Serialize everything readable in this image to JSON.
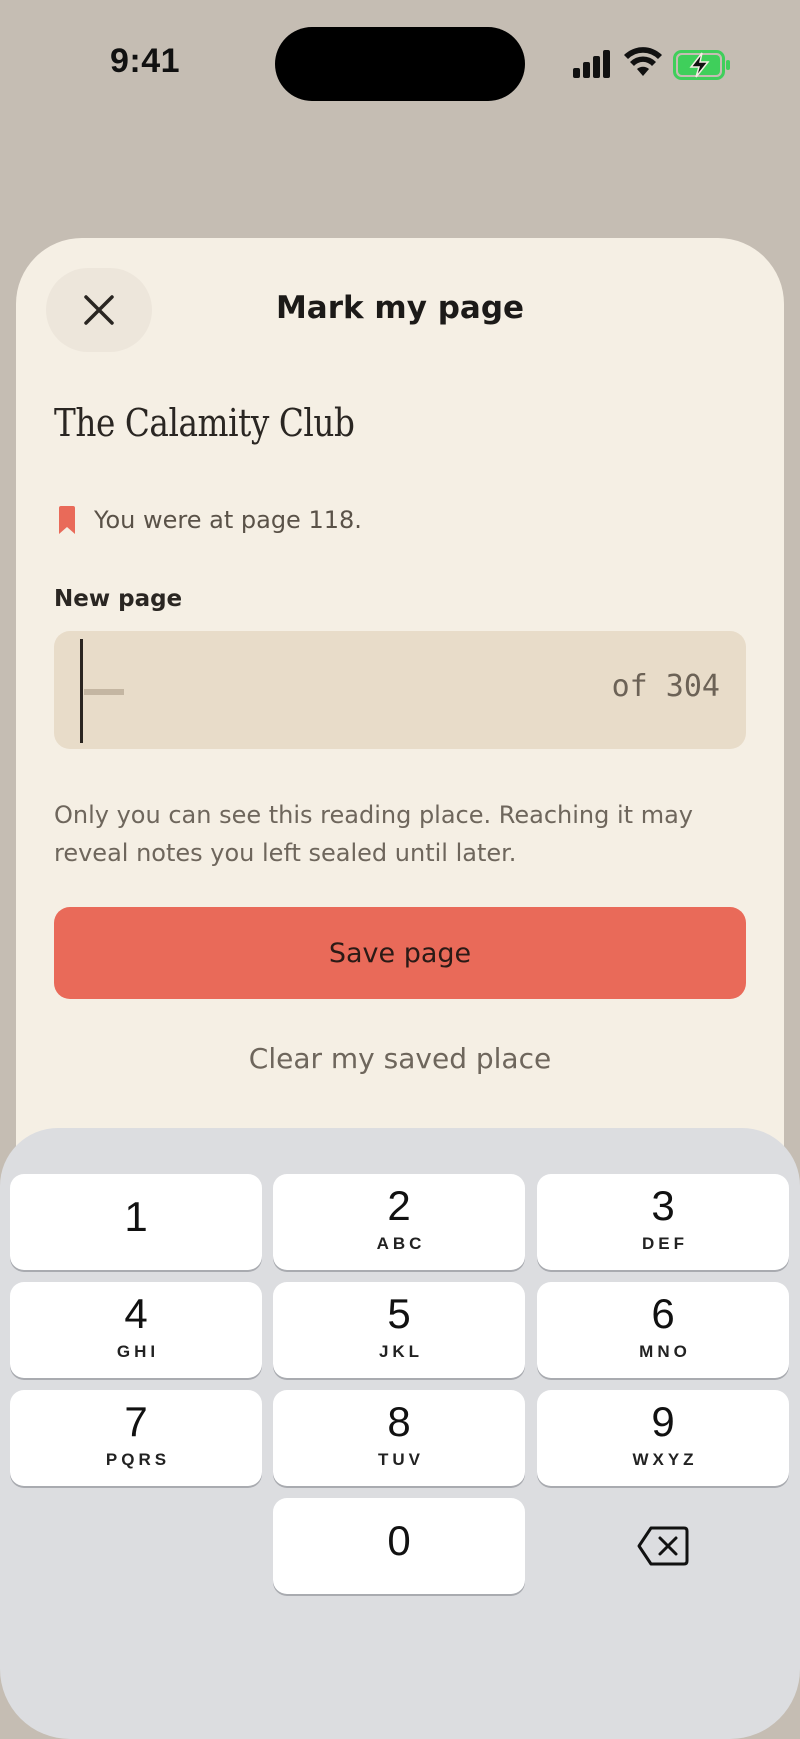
{
  "status_bar": {
    "time": "9:41",
    "icons": [
      "cellular-signal-icon",
      "wifi-icon",
      "battery-charging-icon"
    ],
    "battery_color": "#3fcf5b"
  },
  "sheet": {
    "title": "Mark my page",
    "close_icon": "close-icon",
    "book_title": "The Calamity Club",
    "previous_page_text": "You were at page 118.",
    "bookmark_color": "#e96a59",
    "new_page_label": "New page",
    "page_input": {
      "value": "",
      "total_text": "of 304"
    },
    "hint_text": "Only you can see this reading place. Reaching it may reveal notes you left sealed until later.",
    "save_button_label": "Save page",
    "clear_link_label": "Clear my saved place",
    "accent_color": "#e96a59"
  },
  "keyboard": {
    "keys": [
      {
        "digit": "1",
        "letters": ""
      },
      {
        "digit": "2",
        "letters": "ABC"
      },
      {
        "digit": "3",
        "letters": "DEF"
      },
      {
        "digit": "4",
        "letters": "GHI"
      },
      {
        "digit": "5",
        "letters": "JKL"
      },
      {
        "digit": "6",
        "letters": "MNO"
      },
      {
        "digit": "7",
        "letters": "PQRS"
      },
      {
        "digit": "8",
        "letters": "TUV"
      },
      {
        "digit": "9",
        "letters": "WXYZ"
      },
      {
        "digit": "0",
        "letters": ""
      }
    ],
    "delete_icon": "delete-backspace-icon"
  }
}
